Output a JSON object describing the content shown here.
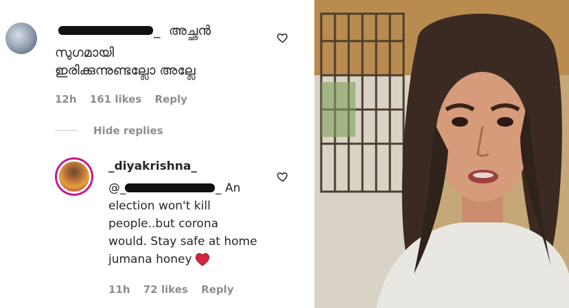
{
  "comment1": {
    "username_suffix": "_",
    "line1": "അച്ഛൻ",
    "line2": "സുഗമായി",
    "line3": "ഇരിക്കുന്നുണ്ടല്ലോ അല്ലേ",
    "time": "12h",
    "likes": "161 likes",
    "reply_label": "Reply"
  },
  "hide_replies_label": "Hide replies",
  "reply1": {
    "username": "_diyakrishna_",
    "mention_prefix": "@_",
    "mention_suffix": "_",
    "line1_tail": "An",
    "line2": "election won't kill",
    "line3": "people..but corona",
    "line4": "would. Stay safe at home",
    "line5": "jumana honey",
    "emoji": "heart-emoji",
    "time": "11h",
    "likes": "72 likes",
    "reply_label": "Reply"
  },
  "colors": {
    "text": "#262626",
    "meta": "#8e8e8e",
    "emoji_red": "#d7263d",
    "story_ring": "#c5188a"
  },
  "icons": [
    "heart-outline-icon",
    "heart-outline-icon",
    "heart-emoji"
  ]
}
